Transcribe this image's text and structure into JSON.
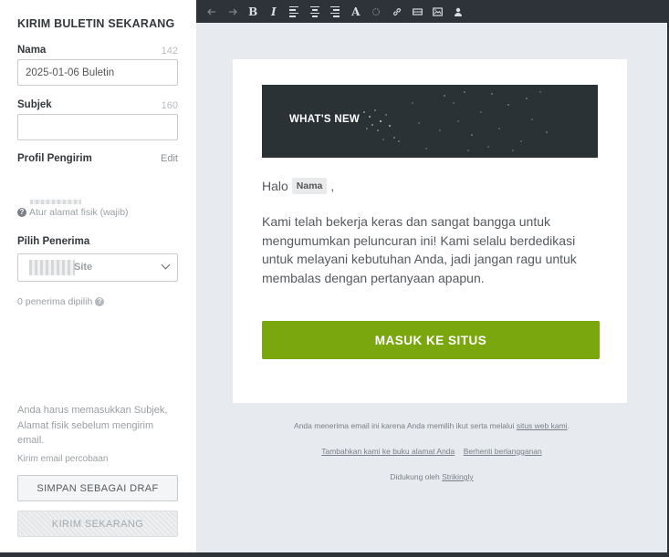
{
  "sidebar": {
    "title": "KIRIM BULETIN SEKARANG",
    "name_label": "Nama",
    "name_count": "142",
    "name_value": "2025-01-06 Buletin",
    "subject_label": "Subjek",
    "subject_count": "160",
    "subject_value": "",
    "sender_label": "Profil Pengirim",
    "edit_label": "Edit",
    "address_hint": "Atur alamat fisik (wajib)",
    "recipients_label": "Pilih Penerima",
    "recipients_value": "Site",
    "recipients_count": "0 penerima dipilih",
    "warning": "Anda harus memasukkan Subjek, Alamat fisik sebelum mengirim email.",
    "test_email": "Kirim email percobaan",
    "draft_button": "SIMPAN SEBAGAI DRAF",
    "send_button": "KIRIM SEKARANG"
  },
  "toolbar": {
    "bold": "B",
    "italic": "I",
    "font": "A"
  },
  "email": {
    "banner_text": "WHAT'S NEW",
    "greeting": "Halo",
    "name_token": "Nama",
    "greeting_punct": ",",
    "body": "Kami telah bekerja keras dan sangat bangga untuk mengumumkan peluncuran ini! Kami selalu berdedikasi untuk melayani kebutuhan Anda, jadi jangan ragu untuk membalas dengan pertanyaan apapun.",
    "cta": "MASUK KE SITUS"
  },
  "footer": {
    "line1_text": "Anda menerima email ini karena Anda memilih ikut serta melalui",
    "line1_link": "situs web kami",
    "line1_end": ".",
    "add_address": "Tambahkan kami ke buku alamat Anda",
    "unsubscribe": "Berhenti berlangganan",
    "powered_text": "Didukung oleh",
    "powered_link": "Strikingly"
  },
  "colors": {
    "accent": "#7ba70e",
    "toolbar": "#2d3338",
    "canvas": "#e7eaee"
  }
}
